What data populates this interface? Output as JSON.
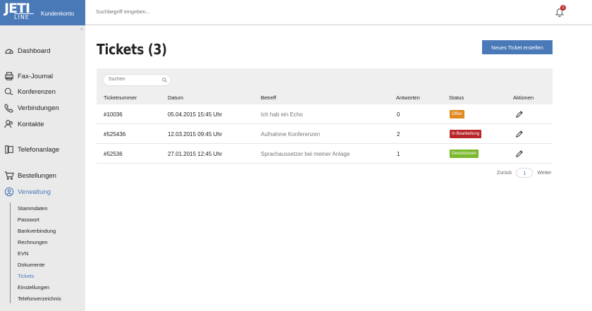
{
  "brand": {
    "logo_top": "JETI",
    "logo_bottom": "LINE",
    "subtitle": "Kundenkonto",
    "collapse_glyph": "«"
  },
  "topbar": {
    "search_placeholder": "Suchbegriff eingeben...",
    "notification_count": "3"
  },
  "nav": [
    {
      "label": "Dashboard",
      "icon": "dashboard-icon"
    },
    {
      "label": "Fax-Journal",
      "icon": "printer-icon"
    },
    {
      "label": "Konferenzen",
      "icon": "chat-icon"
    },
    {
      "label": "Verbindungen",
      "icon": "phone-icon"
    },
    {
      "label": "Kontakte",
      "icon": "contacts-icon"
    },
    {
      "label": "Telefonanlage",
      "icon": "pbx-icon"
    },
    {
      "label": "Bestellungen",
      "icon": "cart-icon"
    },
    {
      "label": "Verwaltung",
      "icon": "admin-icon"
    }
  ],
  "subnav": [
    "Stammdaten",
    "Passwort",
    "Bankverbindung",
    "Rechnungen",
    "EVN",
    "Dokumente",
    "Tickets",
    "Einstellungen",
    "Telefonverzeichnis"
  ],
  "page": {
    "title": "Tickets (3)",
    "new_button": "Neues Ticket erstellen"
  },
  "table": {
    "search_placeholder": "Suchen",
    "headers": [
      "Ticketnummer",
      "Datum",
      "Betreff",
      "Antworten",
      "Status",
      "Aktionen"
    ],
    "rows": [
      {
        "number": "#10036",
        "date": "05.04.2015 15:45 Uhr",
        "subject": "Ich hab ein Echo",
        "answers": "0",
        "status": "Offen",
        "status_color": "#e08a1e"
      },
      {
        "number": "#525436",
        "date": "12.03.2015 09:45 Uhr",
        "subject": "Aufnahme Konferenzen",
        "answers": "2",
        "status": "In Bearbeitung",
        "status_color": "#b8262a"
      },
      {
        "number": "#52536",
        "date": "27.01.2015 12:45 Uhr",
        "subject": "Sprachaussetzer bei meiner Anlage",
        "answers": "1",
        "status": "Geschlossen",
        "status_color": "#7bb82e"
      }
    ]
  },
  "pager": {
    "prev": "Zurück",
    "page": "1",
    "next": "Weiter"
  },
  "colors": {
    "accent": "#4a79b8",
    "sidebar": "#eaeaea"
  }
}
